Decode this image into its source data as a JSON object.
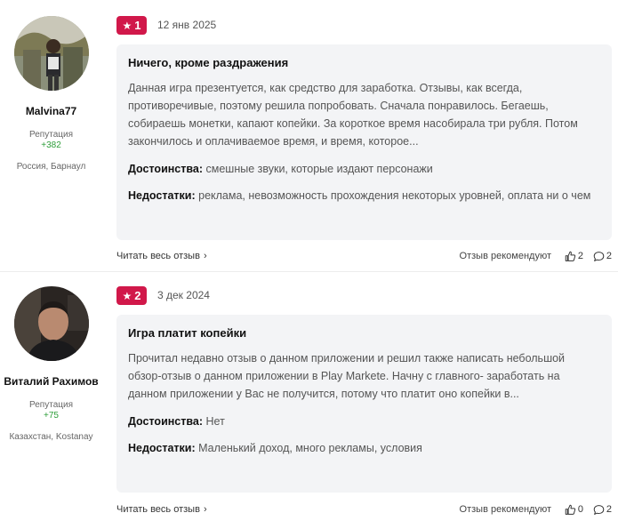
{
  "reviews": [
    {
      "author": {
        "name": "Malvina77",
        "reputation_label": "Репутация",
        "reputation": "+382",
        "location": "Россия, Барнаул"
      },
      "rating": "1",
      "date": "12 янв 2025",
      "title": "Ничего, кроме раздражения",
      "text": "Данная игра презентуется, как средство для заработка. Отзывы, как всегда, противоречивые, поэтому решила попробовать. Сначала понравилось. Бегаешь, собираешь монетки, капают копейки. За короткое время насобирала три рубля. Потом закончилось и оплачиваемое время, и время, которое...",
      "pros_label": "Достоинства:",
      "pros": "смешные звуки, которые издают персонажи",
      "cons_label": "Недостатки:",
      "cons": "реклама, невозможность прохождения некоторых уровней, оплата ни о чем",
      "read_more": "Читать весь отзыв",
      "recommend_label": "Отзыв рекомендуют",
      "likes": "2",
      "comments": "2"
    },
    {
      "author": {
        "name": "Виталий Рахимов",
        "reputation_label": "Репутация",
        "reputation": "+75",
        "location": "Казахстан, Kostanay"
      },
      "rating": "2",
      "date": "3 дек 2024",
      "title": "Игра платит копейки",
      "text": "Прочитал недавно отзыв о данном приложении и решил также написать небольшой обзор-отзыв о данном приложении в Play Markete. Начну с главного- заработать на данном приложении у Вас не получится, потому что платит оно копейки в...",
      "pros_label": "Достоинства:",
      "pros": "Нет",
      "cons_label": "Недостатки:",
      "cons": "Маленький доход, много рекламы, условия",
      "read_more": "Читать весь отзыв",
      "recommend_label": "Отзыв рекомендуют",
      "likes": "0",
      "comments": "2"
    }
  ],
  "icons": {
    "star": "star-icon",
    "thumbs_up": "thumbs-up-icon",
    "comment": "comment-icon",
    "chevron": "chevron-right-icon"
  },
  "colors": {
    "badge": "#d1184a",
    "reputation": "#2e9e3a",
    "card_bg": "#f3f4f6"
  }
}
